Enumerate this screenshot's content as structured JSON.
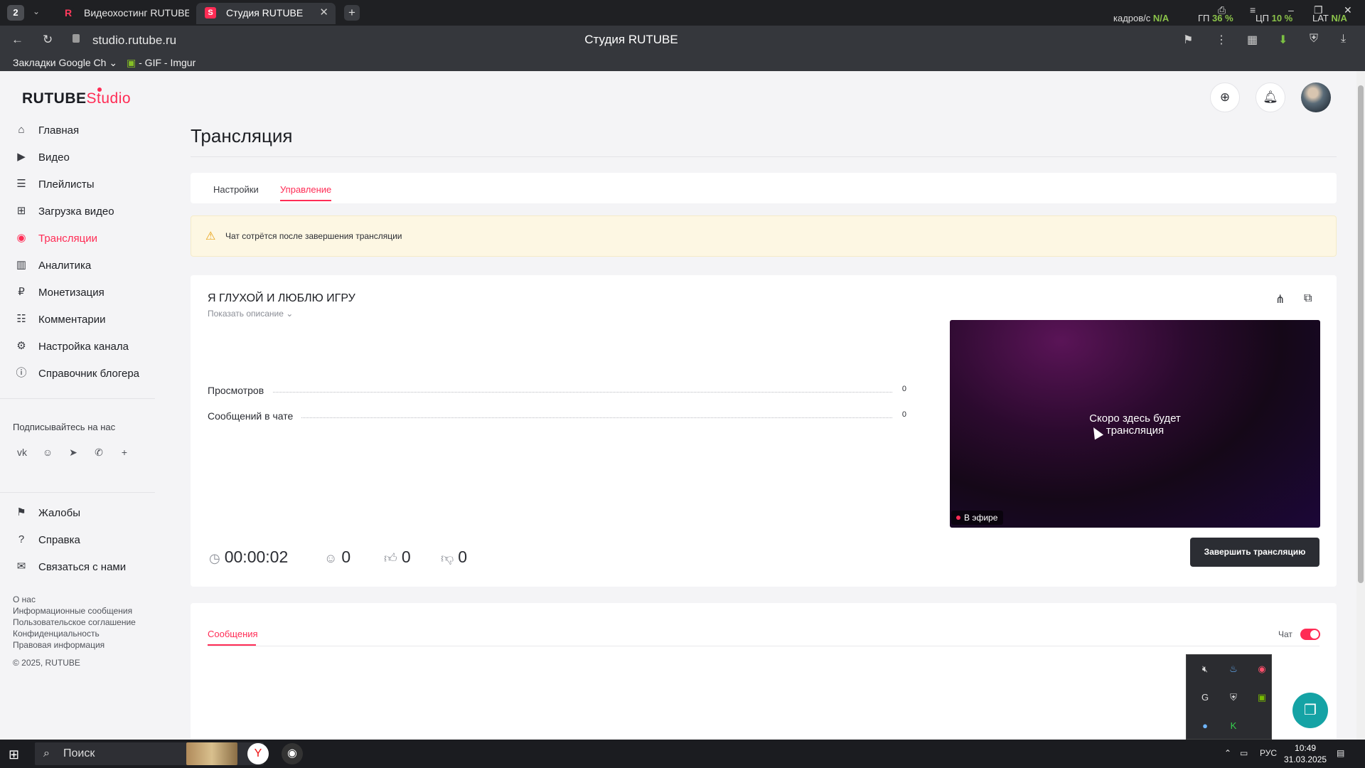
{
  "browser": {
    "tab_count": "2",
    "tabs": [
      {
        "label": "Видеохостинг RUTUBE. С"
      },
      {
        "label": "Студия RUTUBE"
      }
    ],
    "perf": {
      "fps_label": "кадров/с",
      "fps_value": "N/A",
      "gpu_label": "ГП",
      "gpu_value": "36 %",
      "cpu_label": "ЦП",
      "cpu_value": "10 %",
      "lat_label": "LAT",
      "lat_value": "N/A"
    },
    "url": "studio.rutube.ru",
    "page_title": "Студия RUTUBE",
    "bookmarks": [
      {
        "label": "Закладки Google Ch"
      },
      {
        "label": "- GIF - Imgur"
      }
    ]
  },
  "logo": {
    "rutube": "RUTUBE",
    "studio": "Studio"
  },
  "sidebar": {
    "items": [
      {
        "label": "Главная",
        "icon": "home-icon"
      },
      {
        "label": "Видео",
        "icon": "video-icon"
      },
      {
        "label": "Плейлисты",
        "icon": "playlist-icon"
      },
      {
        "label": "Загрузка видео",
        "icon": "upload-icon"
      },
      {
        "label": "Трансляции",
        "icon": "broadcast-icon",
        "active": true
      },
      {
        "label": "Аналитика",
        "icon": "analytics-icon"
      },
      {
        "label": "Монетизация",
        "icon": "monetization-icon"
      },
      {
        "label": "Комментарии",
        "icon": "comments-icon"
      },
      {
        "label": "Настройка канала",
        "icon": "settings-icon"
      },
      {
        "label": "Справочник блогера",
        "icon": "guide-icon"
      }
    ],
    "subscribe_label": "Подписывайтесь на нас",
    "bottom_items": [
      {
        "label": "Жалобы",
        "icon": "flag-icon"
      },
      {
        "label": "Справка",
        "icon": "help-icon"
      },
      {
        "label": "Связаться с нами",
        "icon": "mail-icon"
      }
    ],
    "footer_links": [
      "О нас",
      "Информационные сообщения",
      "Пользовательское соглашение",
      "Конфиденциальность",
      "Правовая информация"
    ],
    "copyright": "© 2025, RUTUBE"
  },
  "page": {
    "title": "Трансляция",
    "tabs": [
      {
        "label": "Настройки"
      },
      {
        "label": "Управление",
        "active": true
      }
    ],
    "warning": "Чат сотрётся после завершения трансляции"
  },
  "stream": {
    "title": "Я ГЛУХОЙ И ЛЮБЛЮ ИГРУ",
    "show_description": "Показать описание",
    "stats": [
      {
        "label": "Просмотров",
        "value": "0"
      },
      {
        "label": "Сообщений в чате",
        "value": "0"
      }
    ],
    "player_message_line1": "Скоро здесь будет",
    "player_message_line2": "трансляция",
    "live_badge": "В эфире",
    "duration": "00:00:02",
    "viewers": "0",
    "likes": "0",
    "dislikes": "0",
    "end_button": "Завершить трансляцию"
  },
  "chat": {
    "tab_label": "Сообщения",
    "toggle_label": "Чат",
    "enabled": true
  },
  "taskbar": {
    "search_label": "Поиск",
    "lang": "РУС",
    "time": "10:49",
    "date": "31.03.2025"
  },
  "colors": {
    "accent": "#ff2c55",
    "dark_button": "#2b2d33",
    "warning_bg": "#fdf7e3"
  }
}
